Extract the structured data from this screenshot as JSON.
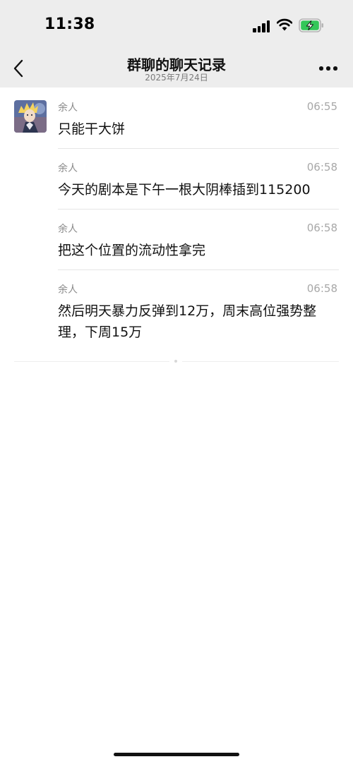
{
  "status_bar": {
    "time": "11:38",
    "icons": [
      "signal-icon",
      "wifi-icon",
      "battery-charging-icon"
    ]
  },
  "nav": {
    "back_icon": "chevron-left-icon",
    "title": "群聊的聊天记录",
    "subtitle": "2025年7月24日",
    "more_icon": "more-dots-icon"
  },
  "messages": [
    {
      "sender": "余人",
      "time": "06:55",
      "text": "只能干大饼"
    },
    {
      "sender": "余人",
      "time": "06:58",
      "text": "今天的剧本是下午一根大阴棒插到115200"
    },
    {
      "sender": "余人",
      "time": "06:58",
      "text": "把这个位置的流动性拿完"
    },
    {
      "sender": "余人",
      "time": "06:58",
      "text": "然后明天暴力反弹到12万，周末高位强势整理，下周15万"
    }
  ],
  "colors": {
    "header_bg": "#ededed",
    "page_bg": "#ffffff",
    "sender": "#8a8a8a",
    "timestamp": "#a8a8a8",
    "battery_charging": "#34c759"
  }
}
